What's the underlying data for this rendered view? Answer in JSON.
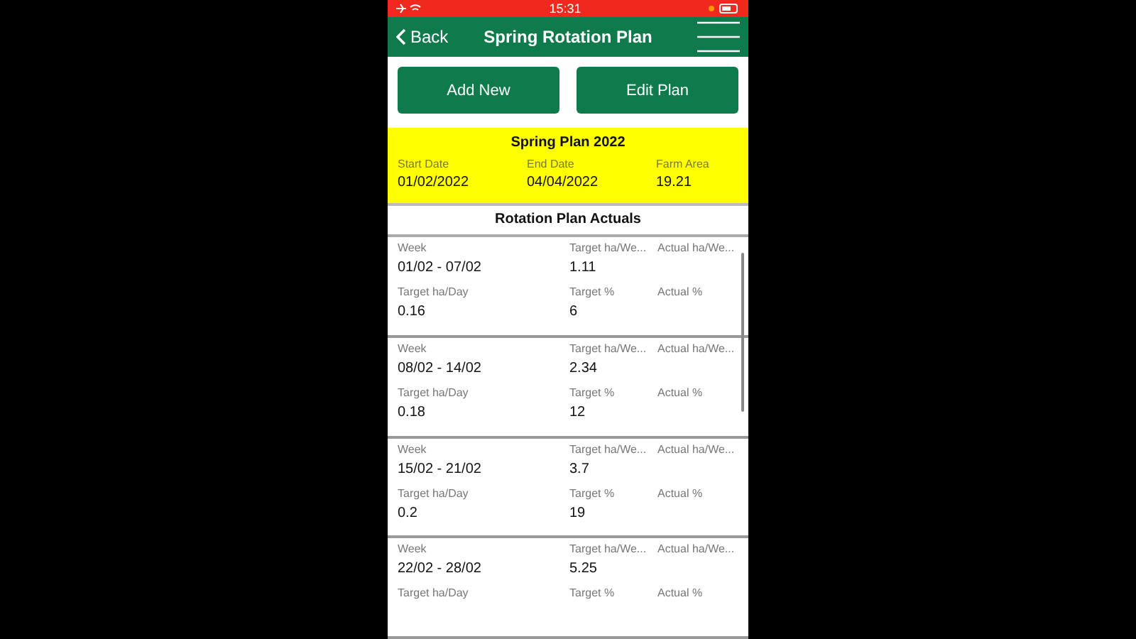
{
  "status_bar": {
    "time": "15:31"
  },
  "header": {
    "back": "Back",
    "title": "Spring Rotation Plan"
  },
  "buttons": [
    "Add New",
    "Edit Plan"
  ],
  "plan": {
    "title": "Spring Plan 2022",
    "fields": [
      {
        "label": "Start Date",
        "value": "01/02/2022"
      },
      {
        "label": "End Date",
        "value": "04/04/2022"
      },
      {
        "label": "Farm Area",
        "value": "19.21"
      }
    ]
  },
  "actuals": {
    "title": "Rotation Plan Actuals",
    "rows": [
      {
        "cells": [
          {
            "label": "Week",
            "value": "01/02 - 07/02"
          },
          {
            "label": "Target ha/We...",
            "value": "1.11"
          },
          {
            "label": "Actual ha/We..."
          },
          {
            "label": "Target ha/Day",
            "value": "0.16"
          },
          {
            "label": "Target %",
            "value": "6"
          },
          {
            "label": "Actual %"
          }
        ]
      },
      {
        "cells": [
          {
            "label": "Week",
            "value": "08/02 - 14/02"
          },
          {
            "label": "Target ha/We...",
            "value": "2.34"
          },
          {
            "label": "Actual ha/We..."
          },
          {
            "label": "Target ha/Day",
            "value": "0.18"
          },
          {
            "label": "Target %",
            "value": "12"
          },
          {
            "label": "Actual %"
          }
        ]
      },
      {
        "cells": [
          {
            "label": "Week",
            "value": "15/02 - 21/02"
          },
          {
            "label": "Target ha/We...",
            "value": "3.7"
          },
          {
            "label": "Actual ha/We..."
          },
          {
            "label": "Target ha/Day",
            "value": "0.2"
          },
          {
            "label": "Target %",
            "value": "19"
          },
          {
            "label": "Actual %"
          }
        ]
      },
      {
        "cells": [
          {
            "label": "Week",
            "value": "22/02 - 28/02"
          },
          {
            "label": "Target ha/We...",
            "value": "5.25"
          },
          {
            "label": "Actual ha/We..."
          },
          {
            "label": "Target ha/Day"
          },
          {
            "label": "Target %"
          },
          {
            "label": "Actual %"
          }
        ]
      }
    ]
  }
}
